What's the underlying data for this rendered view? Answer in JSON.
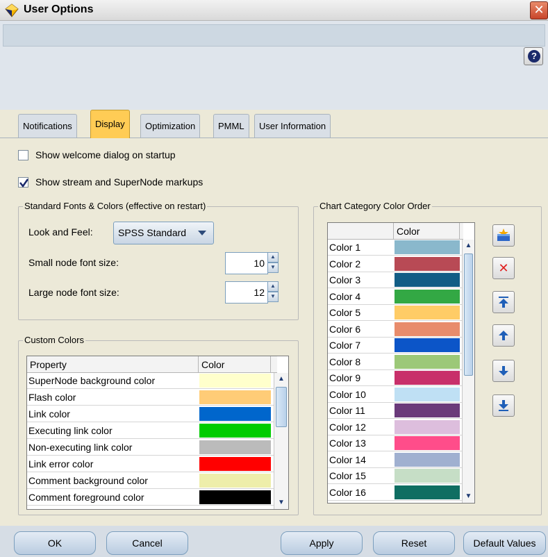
{
  "window": {
    "title": "User Options",
    "close_glyph": "✕",
    "help_glyph": "?"
  },
  "tabs": [
    {
      "label": "Notifications"
    },
    {
      "label": "Display",
      "active": true
    },
    {
      "label": "Optimization"
    },
    {
      "label": "PMML"
    },
    {
      "label": "User Information"
    }
  ],
  "options": {
    "show_welcome": {
      "label": "Show welcome dialog on startup",
      "checked": false
    },
    "show_markups": {
      "label": "Show stream and SuperNode markups",
      "checked": true
    }
  },
  "fonts_group": {
    "title": "Standard Fonts & Colors (effective on restart)",
    "look_and_feel_label": "Look and Feel:",
    "look_and_feel_value": "SPSS Standard",
    "small_font_label": "Small node font size:",
    "small_font_value": "10",
    "large_font_label": "Large node font size:",
    "large_font_value": "12"
  },
  "custom_colors": {
    "title": "Custom Colors",
    "headers": [
      "Property",
      "Color"
    ],
    "rows": [
      {
        "property": "SuperNode background color",
        "color": "#ffffcc"
      },
      {
        "property": "Flash color",
        "color": "#ffcc77"
      },
      {
        "property": "Link color",
        "color": "#0066cc"
      },
      {
        "property": "Executing link color",
        "color": "#00cc00"
      },
      {
        "property": "Non-executing link color",
        "color": "#bbbbbb"
      },
      {
        "property": "Link error color",
        "color": "#ff0000"
      },
      {
        "property": "Comment background color",
        "color": "#eeeeaa"
      },
      {
        "property": "Comment foreground color",
        "color": "#000000"
      }
    ]
  },
  "chart_colors": {
    "title": "Chart Category Color Order",
    "header": "Color",
    "rows": [
      {
        "name": "Color 1",
        "color": "#8ab8cc"
      },
      {
        "name": "Color 2",
        "color": "#b84a55"
      },
      {
        "name": "Color 3",
        "color": "#125d85"
      },
      {
        "name": "Color 4",
        "color": "#33a844"
      },
      {
        "name": "Color 5",
        "color": "#ffcc66"
      },
      {
        "name": "Color 6",
        "color": "#e88c6c"
      },
      {
        "name": "Color 7",
        "color": "#0c55c8"
      },
      {
        "name": "Color 8",
        "color": "#9cc878"
      },
      {
        "name": "Color 9",
        "color": "#c8306a"
      },
      {
        "name": "Color 10",
        "color": "#bfe0f4"
      },
      {
        "name": "Color 11",
        "color": "#6a3a7a"
      },
      {
        "name": "Color 12",
        "color": "#ddbedd"
      },
      {
        "name": "Color 13",
        "color": "#ff4d8a"
      },
      {
        "name": "Color 14",
        "color": "#a0b0d0"
      },
      {
        "name": "Color 15",
        "color": "#c6dec6"
      },
      {
        "name": "Color 16",
        "color": "#0f6e62"
      }
    ],
    "tools": [
      "add-color-icon",
      "delete-icon",
      "move-top-icon",
      "move-up-icon",
      "move-down-icon",
      "move-bottom-icon"
    ]
  },
  "buttons": {
    "ok": "OK",
    "cancel": "Cancel",
    "apply": "Apply",
    "reset": "Reset",
    "defaults": "Default Values"
  }
}
